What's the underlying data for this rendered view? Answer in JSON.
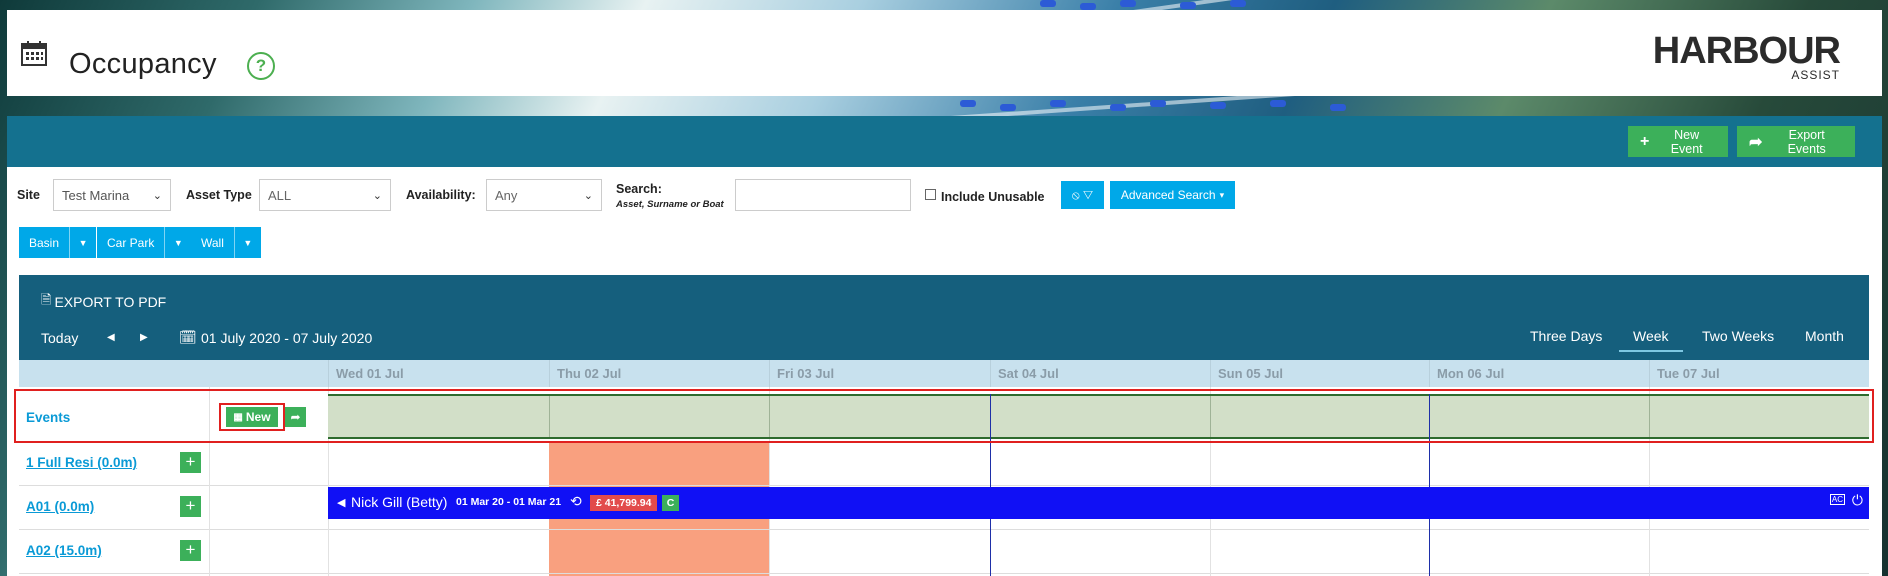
{
  "header": {
    "title": "Occupancy",
    "help": "?",
    "logo_main": "HARBOUR",
    "logo_sub": "ASSIST"
  },
  "actions": {
    "new_event": "New Event",
    "export_events": "Export Events"
  },
  "filters": {
    "site_label": "Site",
    "site_value": "Test Marina",
    "asset_type_label": "Asset Type",
    "asset_type_value": "ALL",
    "availability_label": "Availability:",
    "availability_value": "Any",
    "search_label": "Search:",
    "search_hint": "Asset, Surname or Boat",
    "search_value": "",
    "include_unusable": "Include Unusable",
    "advanced_search": "Advanced Search"
  },
  "group_buttons": [
    "Basin",
    "Car Park",
    "Wall"
  ],
  "calendar": {
    "export_pdf": "EXPORT TO PDF",
    "today": "Today",
    "date_range": "01 July 2020 - 07 July 2020",
    "views": [
      "Three Days",
      "Week",
      "Two Weeks",
      "Month"
    ],
    "active_view": "Week",
    "days": [
      "Wed 01 Jul",
      "Thu 02 Jul",
      "Fri 03 Jul",
      "Sat 04 Jul",
      "Sun 05 Jul",
      "Mon 06 Jul",
      "Tue 07 Jul"
    ],
    "events_label": "Events",
    "new_label": "New",
    "rows": [
      {
        "label": "1 Full Resi (0.0m)"
      },
      {
        "label": "A01 (0.0m)"
      },
      {
        "label": "A02 (15.0m)"
      }
    ],
    "booking": {
      "name": "Nick Gill (Betty)",
      "dates": "01 Mar 20 - 01 Mar 21",
      "amount": "£ 41,799.94",
      "status": "C"
    }
  },
  "colors": {
    "band": "#14718f",
    "calendar_header": "#155f7d",
    "green": "#3cb05a",
    "blue_button": "#00a8e8",
    "booking": "#1010f5",
    "highlight": "#e0201f"
  }
}
